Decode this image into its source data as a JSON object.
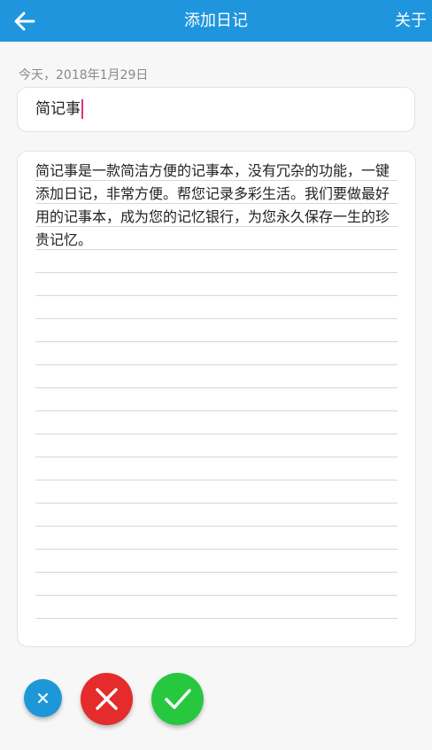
{
  "appbar": {
    "title": "添加日记",
    "about_label": "关于",
    "back_icon": "arrow-left-icon",
    "color": "#1f95dd"
  },
  "diary": {
    "date": "今天，2018年1月29日",
    "title_value": "简记事",
    "content": "简记事是一款简洁方便的记事本，没有冗杂的功能，一键添加日记，非常方便。帮您记录多彩生活。我们要做最好用的记事本，成为您的记忆银行，为您永久保存一生的珍贵记忆。"
  },
  "actions": {
    "small_button_icon": "close-icon",
    "cancel_icon": "close-icon",
    "confirm_icon": "check-icon",
    "colors": {
      "small": "#1d97d8",
      "cancel": "#e52b2b",
      "confirm": "#27c73f"
    }
  }
}
